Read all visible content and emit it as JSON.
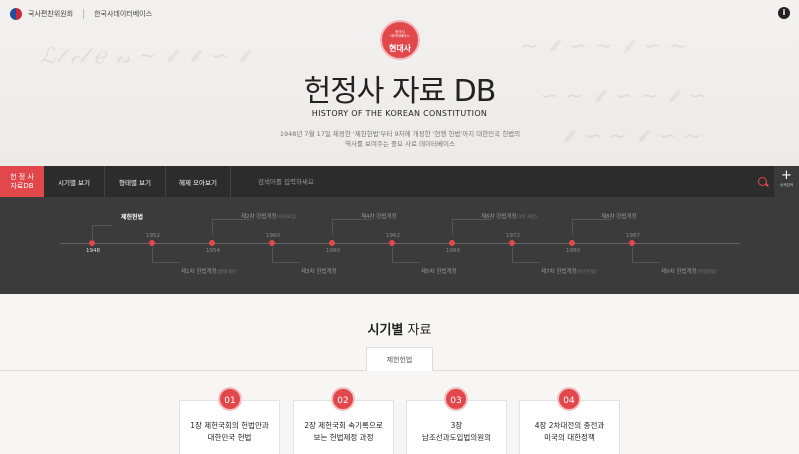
{
  "header": {
    "org_name": "국사편찬위원회",
    "db_name": "한국사데이터베이스",
    "badge_small": "한국사\n데이터베이스",
    "badge_big": "현대사",
    "title": "헌정사 자료 DB",
    "subtitle": "HISTORY OF THE KOREAN CONSTITUTION",
    "description_line1": "1948년 7월 17일 제정한 '제헌헌법'부터 9차에 개정한 '현행 헌법'까지 대한민국 헌법의",
    "description_line2": "역사를 보여주는 중요 사료 데이터베이스"
  },
  "nav": {
    "home_line1": "헌 정 사",
    "home_line2": "자료DB",
    "items": [
      "시기별 보기",
      "형태별 보기",
      "헤제 모아보기"
    ],
    "search_placeholder": "검색어를 입력하세요",
    "detail_search": "상세검색"
  },
  "timeline": {
    "years": [
      "1948",
      "1952",
      "1954",
      "1960",
      "1960",
      "1962",
      "1969",
      "1972",
      "1980",
      "1987"
    ],
    "top_labels": [
      {
        "text": "제헌헌법",
        "sub": ""
      },
      {
        "text": "제2차 헌법개정",
        "sub": "(사사오입)"
      },
      {
        "text": "제4차 헌법개정",
        "sub": ""
      },
      {
        "text": "제6차 헌법개정",
        "sub": "(3선 개헌)"
      },
      {
        "text": "제8차 헌법개정",
        "sub": ""
      }
    ],
    "bottom_labels": [
      {
        "text": "제1차 헌법개정",
        "sub": "(발췌개헌)"
      },
      {
        "text": "제3차 헌법개정",
        "sub": ""
      },
      {
        "text": "제5차 헌법개정",
        "sub": ""
      },
      {
        "text": "제7차 헌법개정",
        "sub": "(유신헌법)"
      },
      {
        "text": "제9차 헌법개정",
        "sub": "(현행헌법)"
      }
    ]
  },
  "section": {
    "title_bold": "시기별",
    "title_rest": " 자료",
    "tab": "제헌헌법"
  },
  "cards": [
    {
      "num": "01",
      "line1": "1장 제헌국회의 헌법안과",
      "line2": "대한민국 헌법"
    },
    {
      "num": "02",
      "line1": "2장 제헌국회 속기록으로",
      "line2": "보는 헌법제정 과정"
    },
    {
      "num": "03",
      "line1": "3장",
      "line2": "남조선과도입법의원의"
    },
    {
      "num": "04",
      "line1": "4장 2차대전의 종전과",
      "line2": "미국의 대한정책"
    }
  ],
  "colors": {
    "accent": "#e2474c",
    "nav_bg": "#2c2c2c",
    "timeline_bg": "#3b3b3b"
  }
}
